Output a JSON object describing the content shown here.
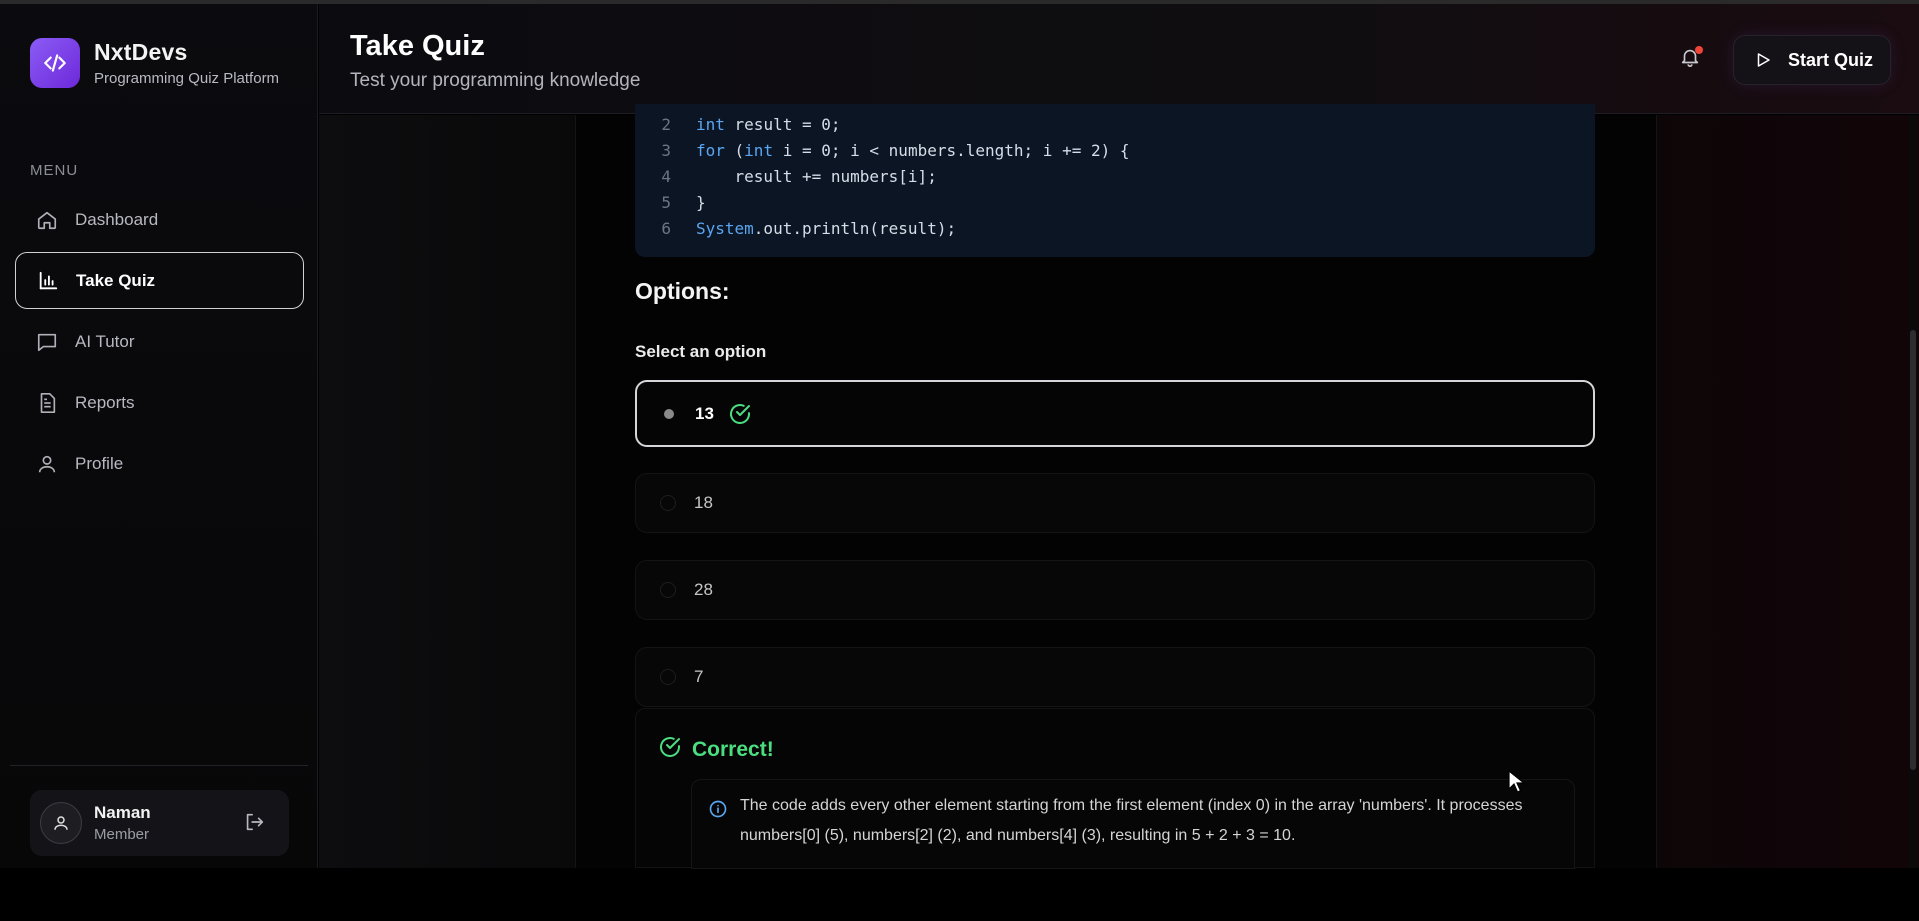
{
  "app": {
    "name": "NxtDevs",
    "tagline": "Programming Quiz Platform"
  },
  "sidebar": {
    "menu_label": "MENU",
    "items": [
      {
        "label": "Dashboard",
        "icon": "home-icon",
        "active": false
      },
      {
        "label": "Take Quiz",
        "icon": "bar-chart-icon",
        "active": true
      },
      {
        "label": "AI Tutor",
        "icon": "message-icon",
        "active": false
      },
      {
        "label": "Reports",
        "icon": "document-icon",
        "active": false
      },
      {
        "label": "Profile",
        "icon": "user-icon",
        "active": false
      }
    ],
    "user": {
      "name": "Naman",
      "role": "Member"
    }
  },
  "header": {
    "title": "Take Quiz",
    "subtitle": "Test your programming knowledge",
    "start_button": "Start Quiz"
  },
  "code": {
    "lines": [
      {
        "n": "2",
        "text": "int result = 0;"
      },
      {
        "n": "3",
        "text": "for (int i = 0; i < numbers.length; i += 2) {"
      },
      {
        "n": "4",
        "text": "    result += numbers[i];"
      },
      {
        "n": "5",
        "text": "}"
      },
      {
        "n": "6",
        "text": "System.out.println(result);"
      }
    ]
  },
  "quiz": {
    "options_title": "Options:",
    "select_label": "Select an option",
    "options": [
      {
        "label": "13",
        "selected": true,
        "correct": true
      },
      {
        "label": "18",
        "selected": false
      },
      {
        "label": "28",
        "selected": false
      },
      {
        "label": "7",
        "selected": false
      }
    ],
    "result_title": "Correct!",
    "explanation": "The code adds every other element starting from the first element (index 0) in the array 'numbers'. It processes numbers[0] (5), numbers[2] (2), and numbers[4] (3), resulting in 5 + 2 + 3 = 10."
  },
  "colors": {
    "accent": "#8b5cf6",
    "success": "#4ade80",
    "notification": "#f04438",
    "code_bg": "#0c1524",
    "keyword": "#5aa6f0"
  }
}
